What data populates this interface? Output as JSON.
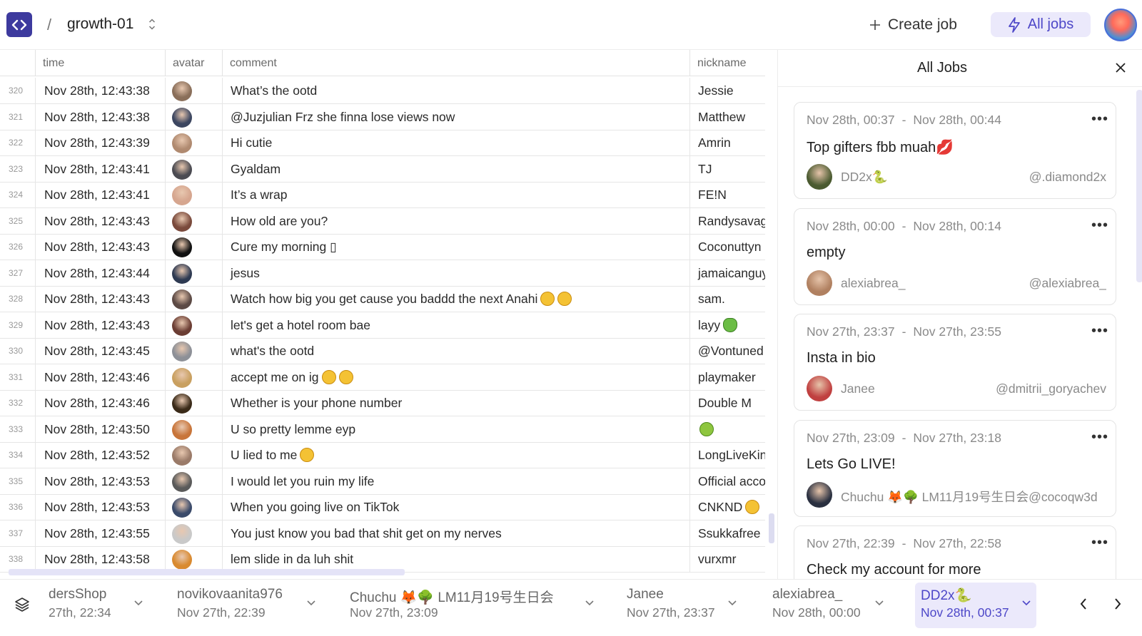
{
  "header": {
    "separator": "/",
    "project": "growth-01",
    "create_job": "Create job",
    "all_jobs": "All jobs"
  },
  "table": {
    "columns": [
      "time",
      "avatar",
      "comment",
      "nickname"
    ],
    "rows": [
      {
        "idx": "320",
        "time": "Nov 28th, 12:43:38",
        "comment": "What’s  the ootd",
        "nickname": "Jessie",
        "av": "#8a6f5a"
      },
      {
        "idx": "321",
        "time": "Nov 28th, 12:43:38",
        "comment": "@Juzjulian Frz she finna lose views now",
        "nickname": "Matthew",
        "av": "#3c4660"
      },
      {
        "idx": "322",
        "time": "Nov 28th, 12:43:39",
        "comment": "Hi cutie",
        "nickname": "Amrin",
        "av": "#b08a70"
      },
      {
        "idx": "323",
        "time": "Nov 28th, 12:43:41",
        "comment": "Gyaldam",
        "nickname": "TJ",
        "av": "#4b4b52"
      },
      {
        "idx": "324",
        "time": "Nov 28th, 12:43:41",
        "comment": "It’s a wrap",
        "nickname": "FE!N",
        "av": "#d6a68f"
      },
      {
        "idx": "325",
        "time": "Nov 28th, 12:43:43",
        "comment": "How old are you?",
        "nickname": "Randysavage",
        "av": "#7a4a3c"
      },
      {
        "idx": "326",
        "time": "Nov 28th, 12:43:43",
        "comment": "Cure my morning ▯",
        "nickname": "Coconuttyn",
        "av": "#111111"
      },
      {
        "idx": "327",
        "time": "Nov 28th, 12:43:44",
        "comment": "jesus",
        "nickname": "jamaicanguy",
        "av": "#2e3a52"
      },
      {
        "idx": "328",
        "time": "Nov 28th, 12:43:43",
        "comment": "Watch how big you get cause you baddd the next Anahi",
        "nickname": "sam.",
        "av": "#5c4a45",
        "emoji": 2
      },
      {
        "idx": "329",
        "time": "Nov 28th, 12:43:43",
        "comment": "let's get a hotel room bae",
        "nickname": "layy",
        "av": "#6b3d33",
        "nick_emoji": "plant"
      },
      {
        "idx": "330",
        "time": "Nov 28th, 12:43:45",
        "comment": "what's the ootd",
        "nickname": "@Vontuned",
        "av": "#8d9097"
      },
      {
        "idx": "331",
        "time": "Nov 28th, 12:43:46",
        "comment": "accept me on ig",
        "nickname": "playmaker",
        "av": "#c9a060",
        "emoji": 2
      },
      {
        "idx": "332",
        "time": "Nov 28th, 12:43:46",
        "comment": "Whether is your phone number",
        "nickname": "Double M",
        "av": "#3a2a18"
      },
      {
        "idx": "333",
        "time": "Nov 28th, 12:43:50",
        "comment": "U so pretty lemme eyp",
        "nickname": "",
        "av": "#c8753a",
        "nick_emoji": "alien"
      },
      {
        "idx": "334",
        "time": "Nov 28th, 12:43:52",
        "comment": "U lied to me",
        "nickname": "LongLiveKing",
        "av": "#9a7a68",
        "emoji": 1
      },
      {
        "idx": "335",
        "time": "Nov 28th, 12:43:53",
        "comment": "I would let you ruin my life",
        "nickname": "Official account",
        "av": "#5a5a5a"
      },
      {
        "idx": "336",
        "time": "Nov 28th, 12:43:53",
        "comment": "When you going live on TikTok",
        "nickname": "CNKND",
        "av": "#3a4a6a",
        "nick_emoji": "smile"
      },
      {
        "idx": "337",
        "time": "Nov 28th, 12:43:55",
        "comment": "You just know you bad that shit get on my nerves",
        "nickname": "Ssukkafree",
        "av": "#c9c9c9"
      },
      {
        "idx": "338",
        "time": "Nov 28th, 12:43:58",
        "comment": "lem slide in da luh shit",
        "nickname": "vurxmr",
        "av": "#d98a30"
      }
    ]
  },
  "panel": {
    "title": "All Jobs",
    "jobs": [
      {
        "start": "Nov 28th, 00:37",
        "sep": "-",
        "end": "Nov 28th, 00:44",
        "title": "Top gifters fbb muah💋",
        "name": "DD2x🐍",
        "handle": "@.diamond2x",
        "av": "#4a5a30"
      },
      {
        "start": "Nov 28th, 00:00",
        "sep": "-",
        "end": "Nov 28th, 00:14",
        "title": "empty",
        "name": "alexiabrea_",
        "handle": "@alexiabrea_",
        "av": "#b08060"
      },
      {
        "start": "Nov 27th, 23:37",
        "sep": "-",
        "end": "Nov 27th, 23:55",
        "title": "Insta in bio",
        "name": "Janee",
        "handle": "@dmitrii_goryachev",
        "av": "#c04040"
      },
      {
        "start": "Nov 27th, 23:09",
        "sep": "-",
        "end": "Nov 27th, 23:18",
        "title": "Lets Go LIVE!",
        "name": "Chuchu 🦊🌳 LM11月19号生日会@cocoqw3d",
        "handle": "",
        "av": "#2a3040"
      },
      {
        "start": "Nov 27th, 22:39",
        "sep": "-",
        "end": "Nov 27th, 22:58",
        "title": "Check my account for more",
        "name": "",
        "handle": "",
        "av": "#888888"
      }
    ]
  },
  "tabs": [
    {
      "name": "dersShop",
      "time": "27th, 22:34"
    },
    {
      "name": "novikovaanita976",
      "time": "Nov 27th, 22:39"
    },
    {
      "name": "Chuchu 🦊🌳 LM11月19号生日会",
      "time": "Nov 27th, 23:09"
    },
    {
      "name": "Janee",
      "time": "Nov 27th, 23:37"
    },
    {
      "name": "alexiabrea_",
      "time": "Nov 28th, 00:00"
    },
    {
      "name": "DD2x🐍",
      "time": "Nov 28th, 00:37"
    }
  ],
  "colors": {
    "accent": "#4d47c8",
    "accent_bg": "#ebe9fb",
    "logo": "#3d3a9e"
  }
}
